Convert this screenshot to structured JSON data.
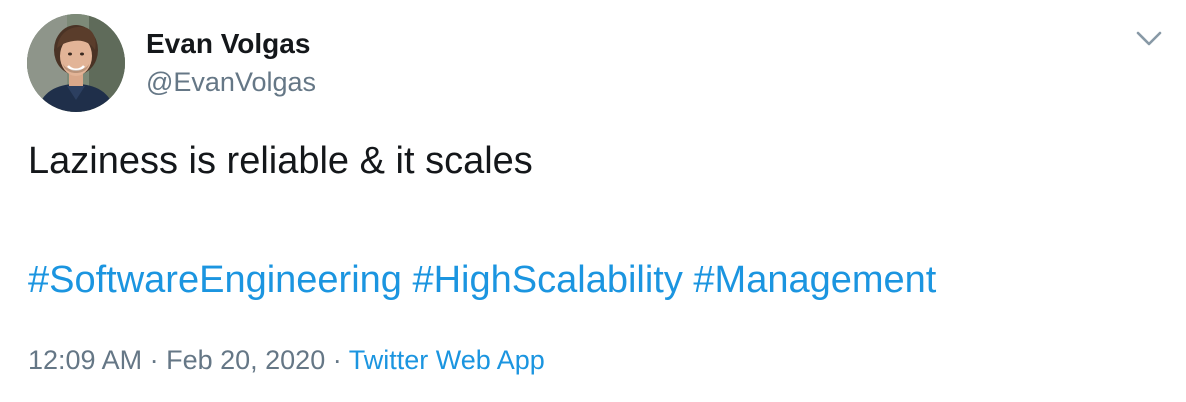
{
  "author": {
    "name": "Evan Volgas",
    "handle": "@EvanVolgas",
    "avatar_icon": "profile-photo"
  },
  "tweet": {
    "text": "Laziness is reliable & it scales",
    "hashtags": [
      "#SoftwareEngineering",
      "#HighScalability",
      "#Management"
    ]
  },
  "meta": {
    "time": "12:09 AM",
    "separator": " · ",
    "date": "Feb 20, 2020",
    "separator2": " · ",
    "source": "Twitter Web App"
  },
  "icons": {
    "menu": "chevron-down-icon"
  },
  "colors": {
    "text": "#14171a",
    "secondary": "#657786",
    "link": "#1b95e0"
  }
}
